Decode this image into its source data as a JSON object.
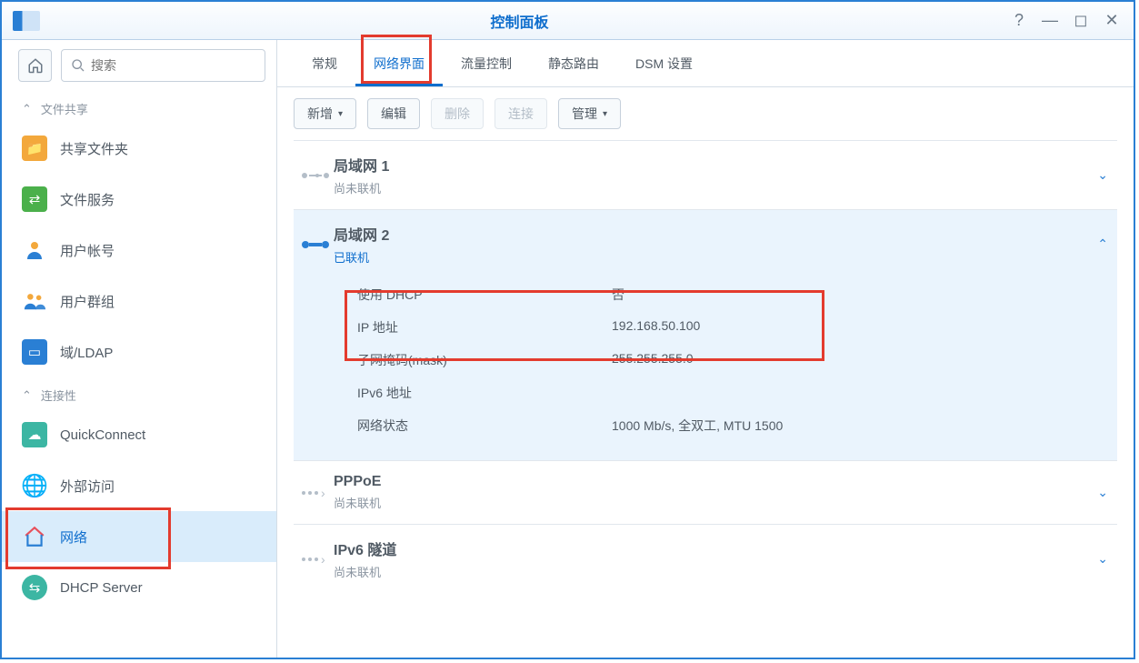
{
  "window": {
    "title": "控制面板"
  },
  "search": {
    "placeholder": "搜索"
  },
  "sidebar": {
    "sections": [
      {
        "label": "文件共享"
      },
      {
        "label": "连接性"
      }
    ],
    "items_a": [
      {
        "label": "共享文件夹"
      },
      {
        "label": "文件服务"
      },
      {
        "label": "用户帐号"
      },
      {
        "label": "用户群组"
      },
      {
        "label": "域/LDAP"
      }
    ],
    "items_b": [
      {
        "label": "QuickConnect"
      },
      {
        "label": "外部访问"
      },
      {
        "label": "网络"
      },
      {
        "label": "DHCP Server"
      }
    ]
  },
  "tabs": [
    {
      "label": "常规"
    },
    {
      "label": "网络界面"
    },
    {
      "label": "流量控制"
    },
    {
      "label": "静态路由"
    },
    {
      "label": "DSM 设置"
    }
  ],
  "toolbar": {
    "add": "新增",
    "edit": "编辑",
    "del": "删除",
    "conn": "连接",
    "manage": "管理"
  },
  "ifaces": {
    "lan1": {
      "name": "局域网 1",
      "status": "尚未联机"
    },
    "lan2": {
      "name": "局域网 2",
      "status": "已联机",
      "k_dhcp": "使用 DHCP",
      "v_dhcp": "否",
      "k_ip": "IP 地址",
      "v_ip": "192.168.50.100",
      "k_mask": "子网掩码(mask)",
      "v_mask": "255.255.255.0",
      "k_ipv6": "IPv6 地址",
      "v_ipv6": "",
      "k_state": "网络状态",
      "v_state": "1000 Mb/s, 全双工, MTU 1500"
    },
    "pppoe": {
      "name": "PPPoE",
      "status": "尚未联机"
    },
    "ipv6t": {
      "name": "IPv6 隧道",
      "status": "尚未联机"
    }
  }
}
